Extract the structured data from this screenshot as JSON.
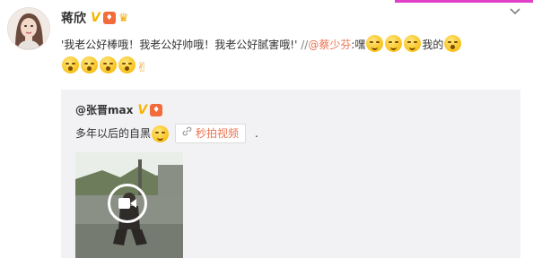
{
  "post": {
    "username": "蒋欣",
    "verified_badge": "V",
    "level_badge": "vip-icon",
    "crown_badge": "crown-icon",
    "more_icon": "chevron-down-icon",
    "text_main": "'我老公好棒哦！我老公好帅哦！我老公好腻害哦!'",
    "repost_sep": "//",
    "mention": "@蔡少芬",
    "text_after_mention": ":嘿",
    "text_mid": "我的",
    "emoji_names": [
      "smirk-emoji",
      "smirk-emoji",
      "smirk-emoji",
      "surprised-emoji",
      "surprised-emoji",
      "surprised-emoji",
      "surprised-emoji",
      "surprised-emoji",
      "rock-hand-emoji"
    ]
  },
  "repost": {
    "username": "@张晋max",
    "verified_badge": "V",
    "text": "多年以后的自黑",
    "link_chip": "秒拍视频",
    "trailing": ".",
    "link_icon": "link-icon",
    "video_icon": "play-video-icon"
  },
  "colors": {
    "link": "#eb7350",
    "repost_bg": "#f2f2f5",
    "text": "#333333",
    "verified": "#f7b500"
  }
}
